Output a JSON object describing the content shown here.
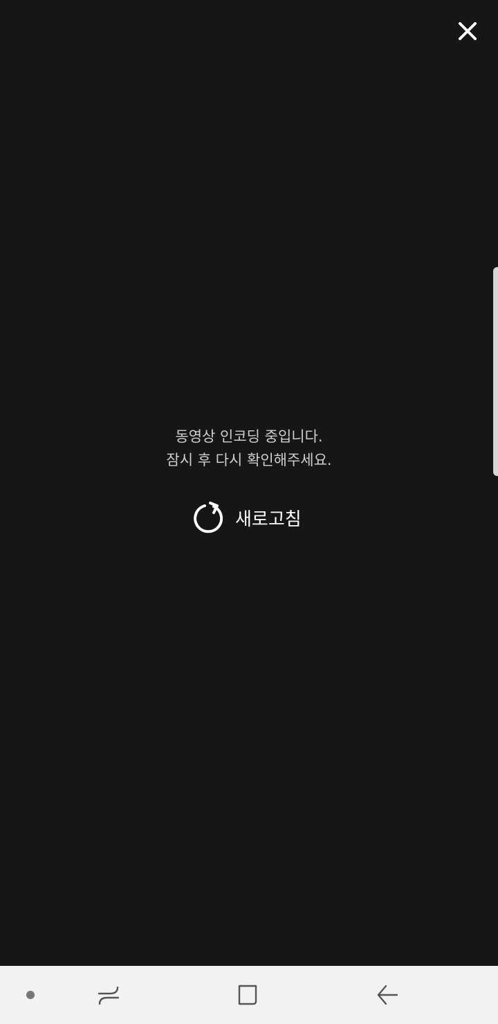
{
  "message": {
    "line1": "동영상 인코딩 중입니다.",
    "line2": "잠시 후 다시 확인해주세요."
  },
  "refresh": {
    "label": "새로고침"
  },
  "icons": {
    "close": "close-icon",
    "refresh": "refresh-icon",
    "recents": "recent-apps-icon",
    "home": "home-icon",
    "back": "back-arrow-icon"
  },
  "colors": {
    "background": "#161616",
    "message_text": "#cfcfcf",
    "refresh_text": "#ffffff",
    "nav_bar": "#f2f2f2"
  }
}
